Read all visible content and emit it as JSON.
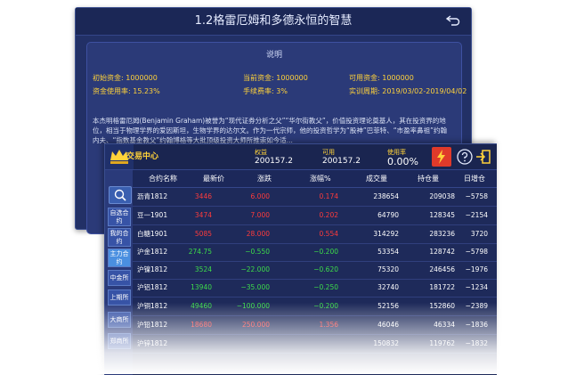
{
  "back_panel": {
    "title": "1.2格雷厄姆和多德永恒的智慧",
    "description_title": "说明",
    "info": [
      {
        "label": "初始资金: 1000000"
      },
      {
        "label": "当前资金: 1000000"
      },
      {
        "label": "可用资金: 1000000"
      },
      {
        "label": "资金使用率: 15.23%"
      },
      {
        "label": "手续费率: 3%"
      },
      {
        "label": "实训周期: 2019/03/02-2019/04/02"
      }
    ],
    "paragraph": "本杰明格雷厄姆(Benjamin Graham)被誉为“现代证券分析之父”“华尔街教父”，价值投资理论奠基人，其在投资界的地位，相当于物理学界的爱因斯坦，生物学界的达尔文。作为一代宗师，他的投资哲学为“股神”巴菲特、“市盈率鼻祖”约翰内夫、“指数基金教父”约翰博格等大批顶级投资大师所推崇如今适..."
  },
  "front_panel": {
    "title": "交易中心",
    "stats": {
      "equity_label": "权益",
      "equity_value": "200157.2",
      "available_label": "可用",
      "available_value": "200157.2",
      "usage_label": "使用率",
      "usage_value": "0.00%"
    },
    "sidebar": [
      {
        "label": "自选合约"
      },
      {
        "label": "我的合约"
      },
      {
        "label": "主力合约"
      },
      {
        "label": "中金所"
      },
      {
        "label": "上期所"
      },
      {
        "label": "大商所"
      },
      {
        "label": "郑商所"
      }
    ],
    "table": {
      "headers": [
        "合约名称",
        "最新价",
        "涨跌",
        "涨幅%",
        "成交量",
        "持仓量",
        "日增仓"
      ],
      "rows": [
        {
          "name": "沥青1812",
          "price": "3446",
          "change": "6.000",
          "pct": "0.174",
          "volume": "238654",
          "oi": "209038",
          "day": "−5758",
          "color": "red"
        },
        {
          "name": "豆一1901",
          "price": "3474",
          "change": "7.000",
          "pct": "0.202",
          "volume": "64790",
          "oi": "128345",
          "day": "−2154",
          "color": "red"
        },
        {
          "name": "白糖1901",
          "price": "5085",
          "change": "28.000",
          "pct": "0.554",
          "volume": "314292",
          "oi": "283236",
          "day": "3720",
          "color": "red"
        },
        {
          "name": "沪金1812",
          "price": "274.75",
          "change": "−0.550",
          "pct": "−0.200",
          "volume": "53354",
          "oi": "128742",
          "day": "−5798",
          "color": "green"
        },
        {
          "name": "沪镍1812",
          "price": "3524",
          "change": "−22.000",
          "pct": "−0.620",
          "volume": "75320",
          "oi": "246456",
          "day": "−1976",
          "color": "green"
        },
        {
          "name": "沪铝1812",
          "price": "13940",
          "change": "−35.000",
          "pct": "−0.250",
          "volume": "32740",
          "oi": "181722",
          "day": "−1234",
          "color": "green"
        },
        {
          "name": "沪铜1812",
          "price": "49460",
          "change": "−100.000",
          "pct": "−0.200",
          "volume": "52156",
          "oi": "152860",
          "day": "−2389",
          "color": "green"
        },
        {
          "name": "沪铅1812",
          "price": "18680",
          "change": "250.000",
          "pct": "1.356",
          "volume": "46046",
          "oi": "46334",
          "day": "−1836",
          "color": "red"
        },
        {
          "name": "沪锌1812",
          "price": "",
          "change": "",
          "pct": "",
          "volume": "150832",
          "oi": "119762",
          "day": "−1832",
          "color": "red"
        }
      ]
    }
  }
}
